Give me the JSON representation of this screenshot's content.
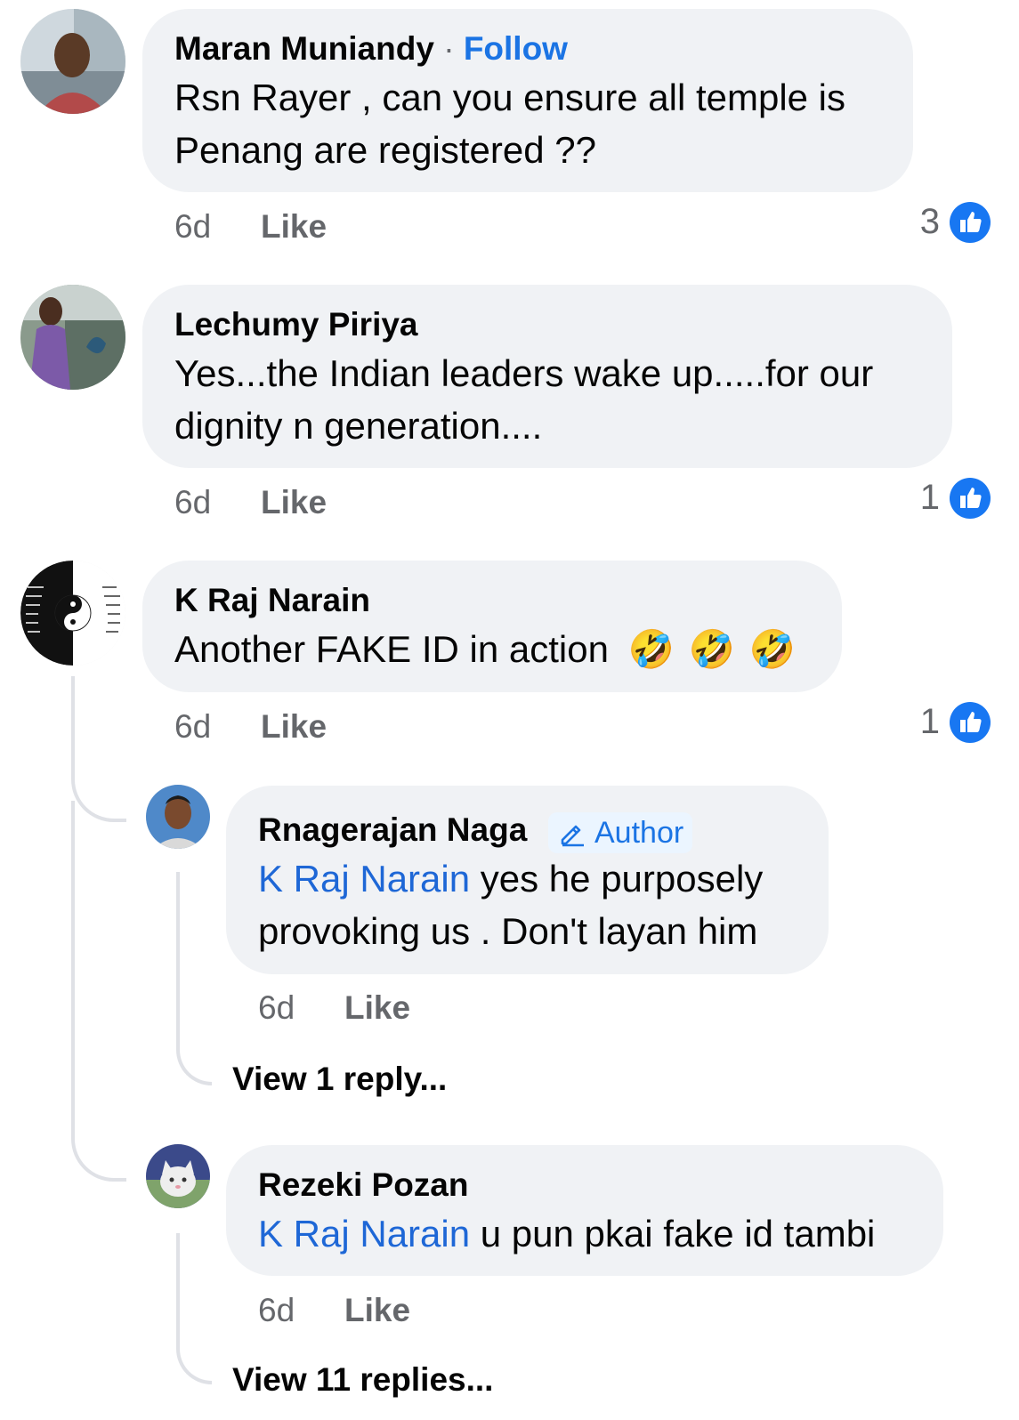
{
  "comments": [
    {
      "author": "Maran Muniandy",
      "separator": "·",
      "follow_label": "Follow",
      "lines": [
        "Rsn Rayer , can you ensure all temple is",
        "Penang are registered ??"
      ],
      "time": "6d",
      "like_label": "Like",
      "reaction_count": "3"
    },
    {
      "author": "Lechumy Piriya",
      "lines": [
        "Yes...the Indian leaders wake up.....for our",
        "dignity n generation...."
      ],
      "time": "6d",
      "like_label": "Like",
      "reaction_count": "1"
    },
    {
      "author": "K Raj Narain",
      "text": "Another FAKE ID in action",
      "emojis": [
        "🤣",
        "🤣",
        "🤣"
      ],
      "time": "6d",
      "like_label": "Like",
      "reaction_count": "1"
    }
  ],
  "replies": [
    {
      "author": "Rnagerajan Naga",
      "badge": "Author",
      "mention": "K Raj Narain",
      "line1_rest": " yes he purposely",
      "line2": "provoking us . Don't layan him",
      "time": "6d",
      "like_label": "Like",
      "view_replies": "View 1 reply..."
    },
    {
      "author": "Rezeki Pozan",
      "mention": "K Raj Narain",
      "line1_rest": " u pun pkai fake id tambi",
      "time": "6d",
      "like_label": "Like",
      "view_replies": "View 11 replies..."
    }
  ],
  "colors": {
    "bubble": "#f0f2f5",
    "link_blue": "#1b74e4",
    "meta_grey": "#65676b",
    "like_blue": "#1877f2"
  }
}
